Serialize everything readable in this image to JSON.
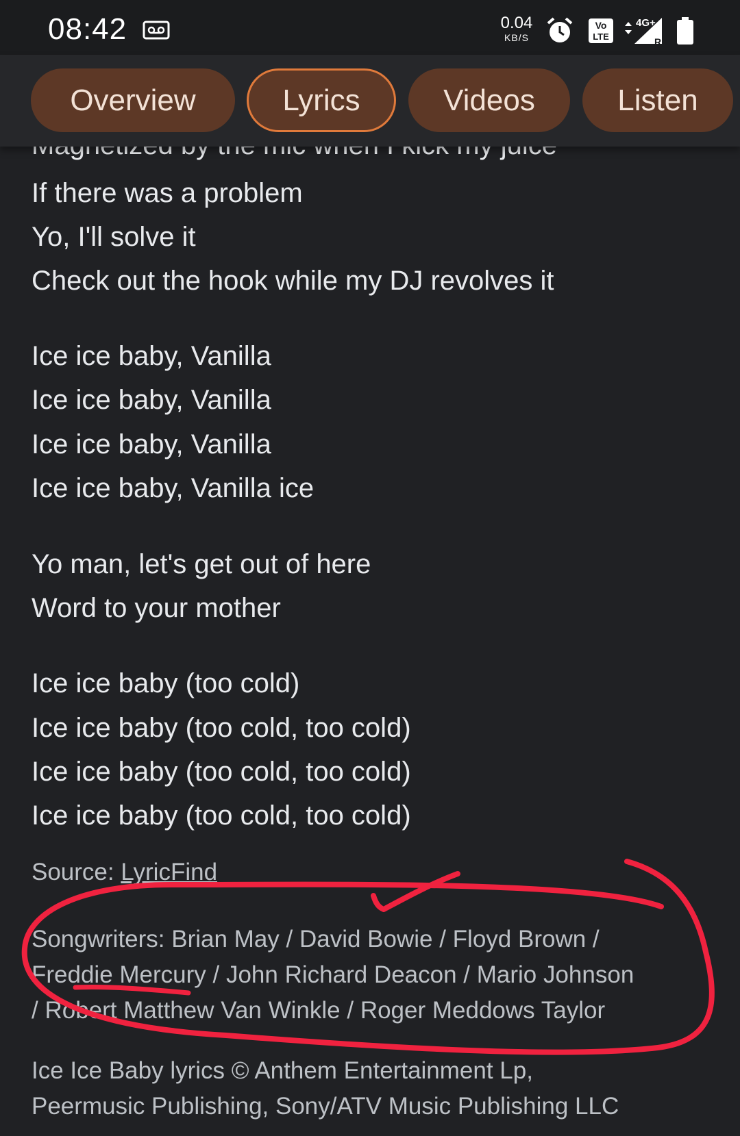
{
  "status_bar": {
    "time": "08:42",
    "net_speed": "0.04",
    "net_speed_unit": "KB/S",
    "icons": [
      "voicemail-icon",
      "alarm-icon",
      "volte-icon",
      "signal-4g-icon",
      "battery-icon"
    ],
    "network": "4G+",
    "roaming": "R",
    "volte_top": "Vo",
    "volte_bottom": "LTE"
  },
  "tabs": [
    {
      "label": "Overview",
      "active": false
    },
    {
      "label": "Lyrics",
      "active": true
    },
    {
      "label": "Videos",
      "active": false
    },
    {
      "label": "Listen",
      "active": false
    }
  ],
  "lyrics": {
    "partial_line": "Magnetized by the mic when I kick my juice",
    "lines": [
      "If there was a problem",
      "Yo, I'll solve it",
      "Check out the hook while my DJ revolves it",
      "Ice ice baby, Vanilla",
      "Ice ice baby, Vanilla",
      "Ice ice baby, Vanilla",
      "Ice ice baby, Vanilla ice",
      "Yo man, let's get out of here",
      "Word to your mother",
      "Ice ice baby (too cold)",
      "Ice ice baby (too cold, too cold)",
      "Ice ice baby (too cold, too cold)",
      "Ice ice baby (too cold, too cold)"
    ]
  },
  "source": {
    "prefix": "Source: ",
    "link": "LyricFind"
  },
  "songwriters": {
    "line1": "Songwriters: Brian May / David Bowie / Floyd Brown /",
    "line2": "Freddie Mercury / John Richard Deacon / Mario Johnson",
    "line3": "/ Robert Matthew Van Winkle / Roger Meddows Taylor"
  },
  "copyright": {
    "line1": "Ice Ice Baby lyrics © Anthem Entertainment Lp,",
    "line2": "Peermusic Publishing, Sony/ATV Music Publishing LLC"
  },
  "colors": {
    "background": "#202124",
    "chip": "#5d3826",
    "chip_active_border": "#e07a3b",
    "annotation": "#f0223f"
  }
}
